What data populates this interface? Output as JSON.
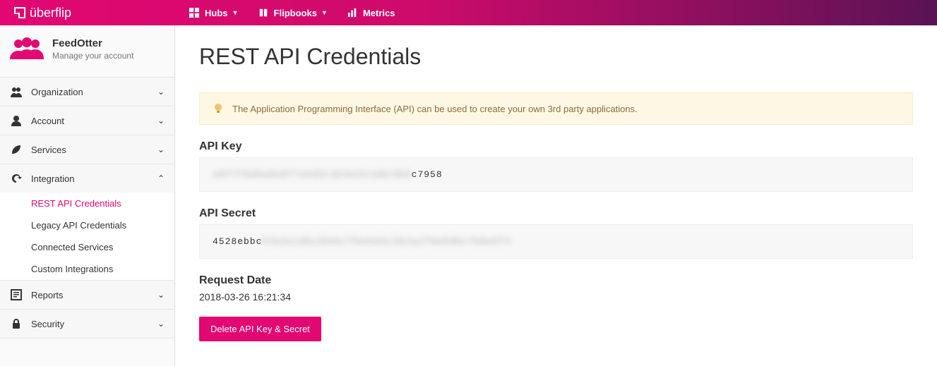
{
  "brand": "überflip",
  "topnav": {
    "hubs": "Hubs",
    "flipbooks": "Flipbooks",
    "metrics": "Metrics"
  },
  "account": {
    "name": "FeedOtter",
    "subtitle": "Manage your account"
  },
  "sidebar": {
    "organization": "Organization",
    "account": "Account",
    "services": "Services",
    "integration": "Integration",
    "integration_items": {
      "rest": "REST API Credentials",
      "legacy": "Legacy API Credentials",
      "connected": "Connected Services",
      "custom": "Custom Integrations"
    },
    "reports": "Reports",
    "security": "Security"
  },
  "page": {
    "title": "REST API Credentials",
    "tip": "The Application Programming Interface (API) can be used to create your own 3rd party applications.",
    "api_key_label": "API Key",
    "api_key_masked": "a8f7f8d8a8e8f7e6d5c4b3a2e1d0c9b8",
    "api_key_visible": "c7958",
    "api_secret_label": "API Secret",
    "api_secret_visible": "4528ebbc",
    "api_secret_masked": "b3a2e1d0c9b8a7f6e5d4c3b2a1f0e9d8c7b6a5f4",
    "request_date_label": "Request Date",
    "request_date_value": "2018-03-26 16:21:34",
    "delete_button": "Delete API Key & Secret"
  }
}
